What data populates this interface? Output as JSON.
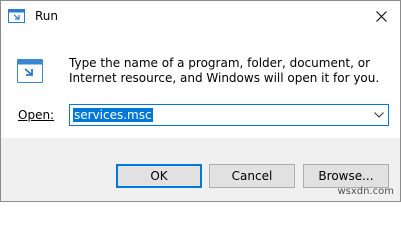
{
  "window": {
    "title": "Run",
    "close_icon": "close-icon",
    "run_icon": "run-app-icon"
  },
  "dialog": {
    "description": "Type the name of a program, folder, document, or Internet resource, and Windows will open it for you.",
    "open_label": "Open:",
    "open_value": "services.msc",
    "dropdown_icon": "chevron-down-icon"
  },
  "buttons": {
    "ok": "OK",
    "cancel": "Cancel",
    "browse": "Browse..."
  },
  "watermark": "wsxdn.com",
  "colors": {
    "accent": "#0078d7",
    "footer_bg": "#f0f0f0",
    "button_bg": "#e1e1e1"
  }
}
